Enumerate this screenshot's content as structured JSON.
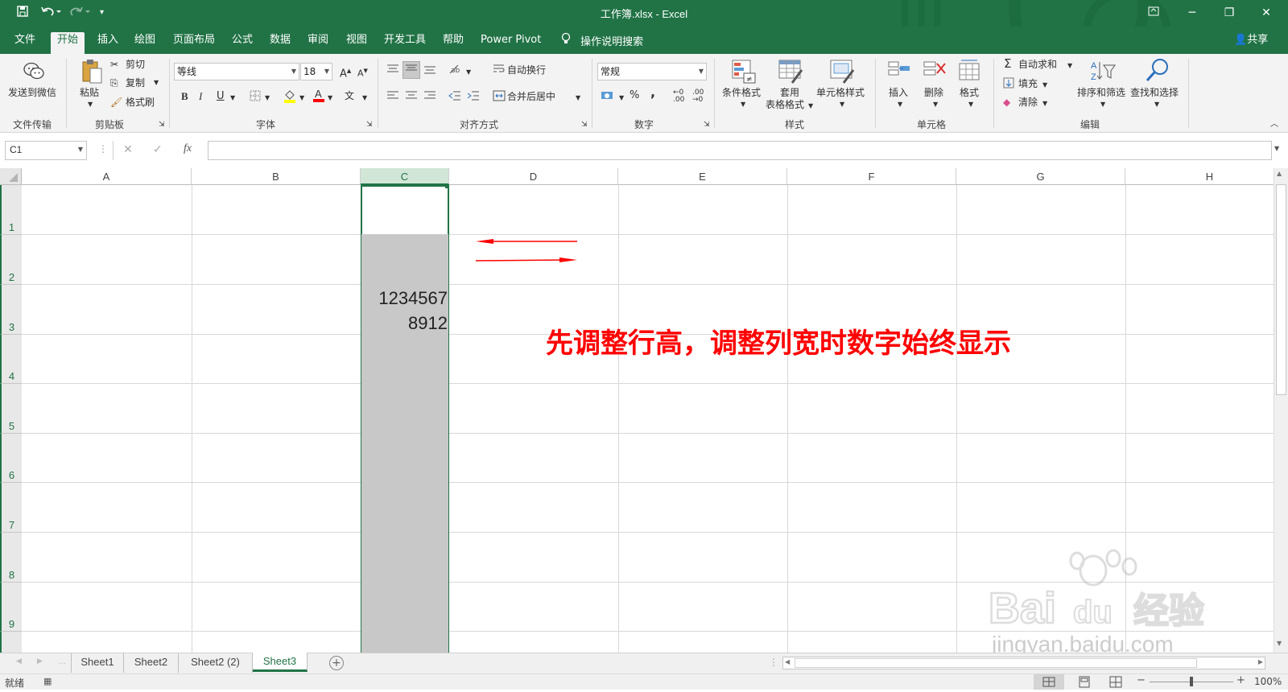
{
  "titlebar": {
    "title": "工作簿.xlsx  -  Excel",
    "save_icon": "save-icon",
    "undo_icon": "undo-icon",
    "redo_icon": "redo-icon",
    "customize_icon": "customize-qat-icon"
  },
  "tabs": [
    {
      "label": "文件"
    },
    {
      "label": "开始"
    },
    {
      "label": "插入"
    },
    {
      "label": "绘图"
    },
    {
      "label": "页面布局"
    },
    {
      "label": "公式"
    },
    {
      "label": "数据"
    },
    {
      "label": "审阅"
    },
    {
      "label": "视图"
    },
    {
      "label": "开发工具"
    },
    {
      "label": "帮助"
    },
    {
      "label": "Power Pivot"
    }
  ],
  "tell_me": "操作说明搜索",
  "share": "共享",
  "ribbon": {
    "file_transfer": {
      "button": "发送到微信",
      "group": "文件传输"
    },
    "clipboard": {
      "paste": "粘贴",
      "cut": "剪切",
      "copy": "复制",
      "format_painter": "格式刷",
      "group": "剪贴板"
    },
    "font": {
      "name": "等线",
      "size": "18",
      "group": "字体",
      "bold": "B",
      "italic": "I",
      "underline": "U"
    },
    "alignment": {
      "wrap": "自动换行",
      "merge": "合并后居中",
      "group": "对齐方式"
    },
    "number": {
      "format": "常规",
      "percent": "%",
      "comma": ",",
      "group": "数字"
    },
    "styles": {
      "conditional": "条件格式",
      "table_line1": "套用",
      "table_line2": "表格格式",
      "cell_styles": "单元格样式",
      "group": "样式"
    },
    "cells": {
      "insert": "插入",
      "delete": "删除",
      "format": "格式",
      "group": "单元格"
    },
    "editing": {
      "autosum": "自动求和",
      "fill": "填充",
      "clear": "清除",
      "sort": "排序和筛选",
      "find": "查找和选择",
      "group": "编辑"
    }
  },
  "formula_bar": {
    "name_box": "C1",
    "fx": "fx",
    "value": ""
  },
  "columns": [
    "A",
    "B",
    "C",
    "D",
    "E",
    "F",
    "G",
    "H"
  ],
  "rows": [
    "1",
    "2",
    "3",
    "4",
    "5",
    "6",
    "7",
    "8",
    "9"
  ],
  "cell_c3": {
    "line1": "1234567",
    "line2": "8912"
  },
  "annotation": {
    "text": "先调整行高，调整列宽时数字始终显示",
    "color": "#ff0000"
  },
  "sheets": [
    {
      "name": "Sheet1",
      "active": false
    },
    {
      "name": "Sheet2",
      "active": false
    },
    {
      "name": "Sheet2 (2)",
      "active": false
    },
    {
      "name": "Sheet3",
      "active": true
    }
  ],
  "status": {
    "ready": "就绪",
    "zoom": "100%"
  },
  "watermark": {
    "logo": "Bai 经验",
    "url": "jingyan.baidu.com"
  },
  "colors": {
    "accent": "#217346",
    "ribbon_bg": "#f3f3f3",
    "selection_fill": "#c8c8c8"
  }
}
